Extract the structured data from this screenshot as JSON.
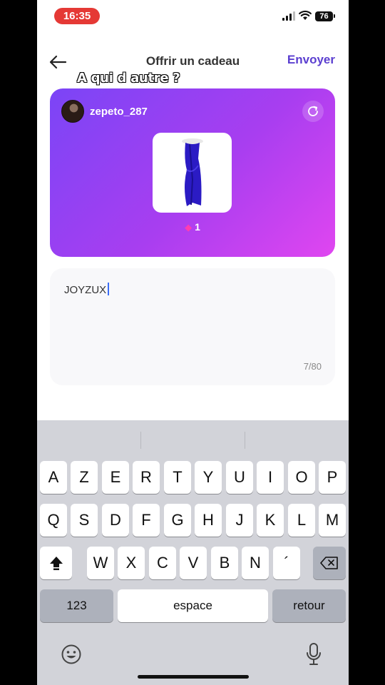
{
  "status_bar": {
    "time": "16:35",
    "battery": "76"
  },
  "header": {
    "title": "Offrir un cadeau",
    "send_label": "Envoyer"
  },
  "overlay_caption": "A qui d autre ?",
  "gift_card": {
    "username": "zepeto_287",
    "price": "1",
    "item_icon": "blue-dress",
    "gradient": [
      "#7b45f6",
      "#e046f0"
    ]
  },
  "message": {
    "value": "JOYZUX",
    "count": "7/80"
  },
  "keyboard": {
    "row1": [
      "A",
      "Z",
      "E",
      "R",
      "T",
      "Y",
      "U",
      "I",
      "O",
      "P"
    ],
    "row2": [
      "Q",
      "S",
      "D",
      "F",
      "G",
      "H",
      "J",
      "K",
      "L",
      "M"
    ],
    "row3": [
      "W",
      "X",
      "C",
      "V",
      "B",
      "N",
      "´"
    ],
    "numbers_label": "123",
    "space_label": "espace",
    "return_label": "retour"
  },
  "colors": {
    "accent": "#5b3fd0",
    "time_pill": "#e53935"
  }
}
